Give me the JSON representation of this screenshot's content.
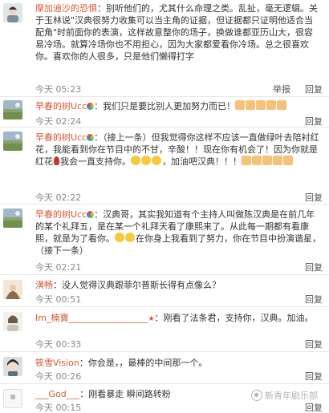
{
  "colors": {
    "name": "#d35930",
    "time": "#888888",
    "divider": "#e6e6e6"
  },
  "comments": [
    {
      "name": "摩加迪沙的恐惧",
      "name_suffix": "",
      "text": "：别听他们的，尤其什么命理之类。乱扯，毫无逻辑。关于玉林说\"汉典很努力收集可以当主角的证据，但证据都只证明他适合当配角\"时前面你的表演，这样故意整你的场子，换做谁都亚历山大，很容易冷场。就算冷场你也不用担心，因为大家都爱看你冷场。总之很喜欢你。喜欢你的人很多，只是他们懒得打字",
      "time": "今天 05:23",
      "actions": [
        "举报",
        "回复"
      ]
    },
    {
      "name": "早春的树Ucc",
      "name_suffix": "",
      "text": "：我们只是要比别人更加努力而已！",
      "thumbs": 5,
      "time": "今天 02:24",
      "actions": [
        "回复"
      ]
    },
    {
      "name": "早春的树Ucc",
      "name_suffix": "",
      "text": "：（接上一条）但我觉得你这样不应该一直做绿叶去陪衬红花，我能看到你在节目中的不甘，辛酸！！现在你有机会了！因为你就是红花",
      "text2": "我会一直支持你。",
      "text3": "，加油吧汉典！！！",
      "thumbs": 5,
      "time": "今天 02:22",
      "actions": [
        "回复"
      ]
    },
    {
      "name": "早春的树Ucc",
      "name_suffix": "",
      "text": "：汉典哥，其实我知道有个主持人叫做陈汉典是在前几年的某个礼拜五，是在某一个礼拜天看了康熙来了。从此每一期都有看康熙，就是为了看你。",
      "text2": "在你身上我看到了努力，你在节目中扮演谐星，（接下一条）",
      "time": "今天 02:21",
      "actions": [
        "回复"
      ]
    },
    {
      "name": "潢畅",
      "name_suffix": "",
      "text": "：没人觉得汉典跟菲尔普斯长得有点像么？",
      "time": "今天 00:51",
      "actions": [
        "回复"
      ]
    },
    {
      "name": "Im_楠寶",
      "name_suffix": "__________________",
      "text": "：刚看了法条君，支持你，汉典。加油。",
      "time": "今天 00:33",
      "actions": [
        "回复"
      ]
    },
    {
      "name": "筱雪Vision",
      "name_suffix": "",
      "text": "：你会是，，最棒的中间那一个。",
      "time": "今天 00:26",
      "actions": [
        "回复"
      ]
    },
    {
      "name": "___God___",
      "name_suffix": "",
      "text": "：刚看暴走 瞬间路转粉",
      "time": "今天 00:15",
      "actions": [
        "回复"
      ]
    }
  ],
  "watermark": {
    "text": "新青年剧乐部",
    "icon": "camera-icon"
  }
}
